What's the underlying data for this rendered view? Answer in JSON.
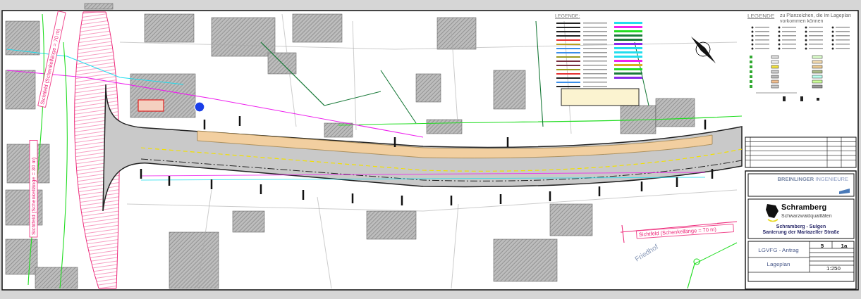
{
  "legend_lines": {
    "title": "LEGENDE:"
  },
  "legend_symbols": {
    "title": "LEGENDE",
    "subtitle": "zu Planzeichen, die im Lageplan vorkommen können"
  },
  "map_labels": [
    {
      "kind": "sightline",
      "text": "Sichtfeld (Schenkellänge = 70 m)"
    },
    {
      "kind": "sightline",
      "text": "Sichtfeld (Schenkellänge = 30 m)"
    },
    {
      "kind": "sightline",
      "text": "Sichtfeld (Schenkellänge = 70 m)"
    },
    {
      "kind": "area",
      "text": "Friedhof"
    }
  ],
  "title_block": {
    "firm": "BREINLINGER",
    "firm_suffix": "INGENIEURE",
    "client": "Schramberg",
    "slogan": "Schwarzwaldqualitäten",
    "project": [
      "Schramberg - Sulgen",
      "Sanierung der Mariazeller Straße"
    ],
    "phase": "LGVFG - Antrag",
    "plan": "Lageplan",
    "annex": "5",
    "plan_number": "1a",
    "scale": "1:250"
  }
}
